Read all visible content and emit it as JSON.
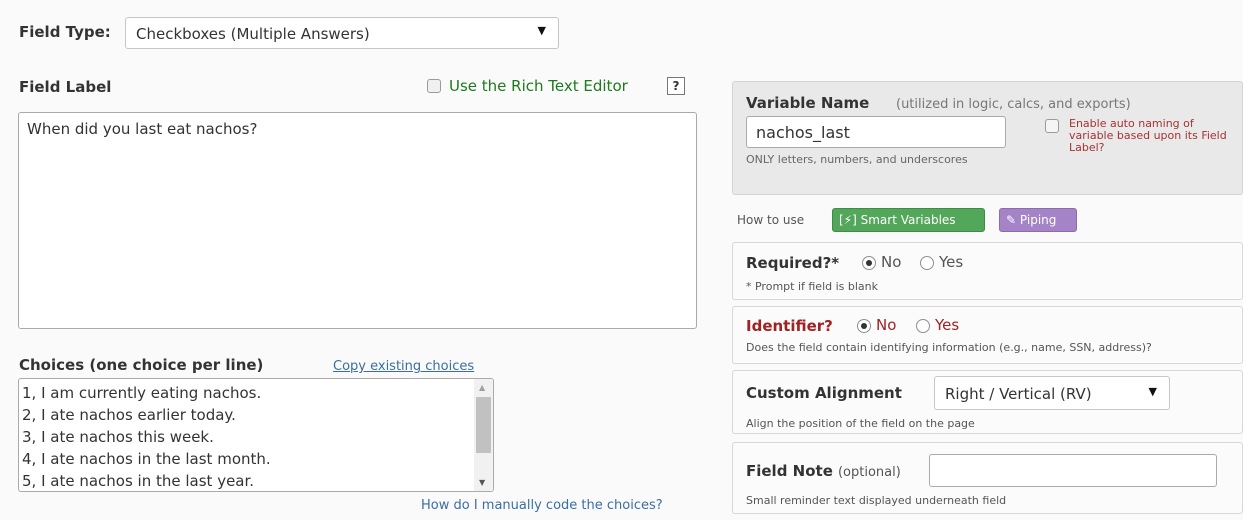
{
  "field_type": {
    "label": "Field Type:",
    "selected": "Checkboxes (Multiple Answers)"
  },
  "field_label": {
    "label": "Field Label",
    "rich_text_label": "Use the Rich Text Editor",
    "help_glyph": "?",
    "value": "When did you last eat nachos?"
  },
  "choices": {
    "label": "Choices (one choice per line)",
    "copy_link": "Copy existing choices",
    "lines": [
      "1, I am currently eating nachos.",
      " 2, I ate nachos earlier today.",
      " 3, I ate nachos this week.",
      " 4, I ate nachos in the last month.",
      " 5, I ate nachos in the last year."
    ],
    "help_link": "How do I manually code the choices?"
  },
  "variable": {
    "title": "Variable Name",
    "subtitle": "(utilized in logic, calcs, and exports)",
    "value": "nachos_last",
    "help": "ONLY letters, numbers, and underscores",
    "auto_naming": "Enable auto naming of variable based upon its Field Label?"
  },
  "howto": {
    "label": "How to use",
    "smart_variables": "[⚡] Smart Variables",
    "piping": "Piping"
  },
  "required": {
    "title": "Required?*",
    "no": "No",
    "yes": "Yes",
    "selected": "No",
    "note": "* Prompt if field is blank"
  },
  "identifier": {
    "title": "Identifier?",
    "no": "No",
    "yes": "Yes",
    "selected": "No",
    "note": "Does the field contain identifying information (e.g., name, SSN, address)?"
  },
  "alignment": {
    "title": "Custom Alignment",
    "selected": "Right / Vertical (RV)",
    "note": "Align the position of the field on the page"
  },
  "field_note": {
    "title": "Field Note",
    "optional": "(optional)",
    "value": "",
    "note": "Small reminder text displayed underneath field"
  },
  "colors": {
    "smart_variables_bg": "#52a75a",
    "piping_bg": "#a484c6",
    "identifier_red": "#a02222",
    "rich_text_green": "#1d7a1d",
    "link_blue": "#3a6ea5"
  }
}
